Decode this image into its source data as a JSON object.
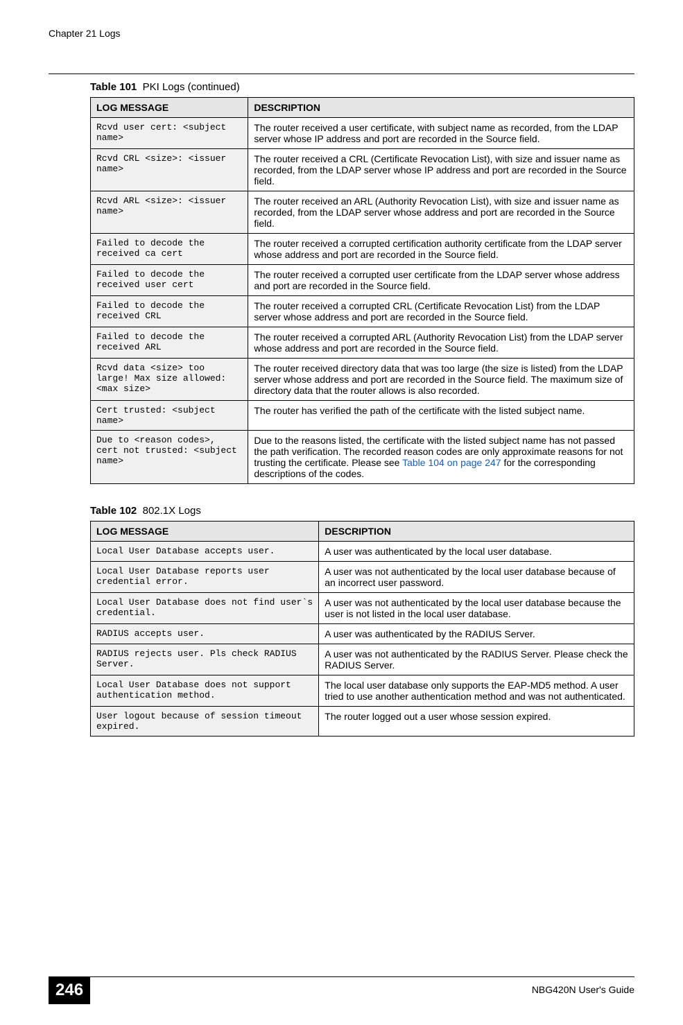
{
  "header": {
    "chapter": "Chapter 21 Logs"
  },
  "table1": {
    "caption_num": "Table 101",
    "caption_text": "PKI Logs (continued)",
    "col1": "LOG MESSAGE",
    "col2": "DESCRIPTION",
    "rows": [
      {
        "msg": "Rcvd user cert: <subject name>",
        "desc": "The router received a user certificate, with subject name as recorded, from the LDAP server whose IP address and port are recorded in the Source field."
      },
      {
        "msg": "Rcvd CRL <size>: <issuer name>",
        "desc": "The router received a CRL (Certificate Revocation List), with size and issuer name as recorded, from the LDAP server whose IP address and port are recorded in the Source field."
      },
      {
        "msg": "Rcvd ARL <size>: <issuer name>",
        "desc": "The router received an ARL (Authority Revocation List), with size and issuer name as recorded, from the LDAP server whose address and port are recorded in the Source field."
      },
      {
        "msg": "Failed to decode the received ca cert",
        "desc": "The router received a corrupted certification authority certificate from the LDAP server whose address and port are recorded in the Source field."
      },
      {
        "msg": "Failed to decode the received user cert",
        "desc": "The router received a corrupted user certificate from the LDAP server whose address and port are recorded in the Source field."
      },
      {
        "msg": "Failed to decode the received CRL",
        "desc": "The router received a corrupted CRL (Certificate Revocation List) from the LDAP server whose address and port are recorded in the Source field."
      },
      {
        "msg": "Failed to decode the received ARL",
        "desc": "The router received a corrupted ARL (Authority Revocation List) from the LDAP server whose address and port are recorded in the Source field."
      },
      {
        "msg": "Rcvd data <size> too large! Max size allowed: <max size>",
        "desc": "The router received directory data that was too large (the size is listed) from the LDAP server whose address and port are recorded in the Source field. The maximum size of directory data that the router allows is also recorded."
      },
      {
        "msg": "Cert trusted: <subject name>",
        "desc": "The router has verified the path of the certificate with the listed subject name."
      },
      {
        "msg": "Due to <reason codes>, cert not trusted: <subject name>",
        "desc_pre": "Due to the reasons listed, the certificate with the listed subject name has not passed the path verification. The recorded reason codes are only approximate reasons for not trusting the certificate. Please see ",
        "desc_link": "Table 104 on page 247",
        "desc_post": " for the corresponding descriptions of the codes."
      }
    ]
  },
  "table2": {
    "caption_num": "Table 102",
    "caption_text": "802.1X Logs",
    "col1": "LOG MESSAGE",
    "col2": "DESCRIPTION",
    "rows": [
      {
        "msg": "Local User Database accepts user.",
        "desc": "A user was authenticated by the local user database."
      },
      {
        "msg": "Local User Database reports user credential error.",
        "desc": "A user was not authenticated by the local user database because of an incorrect user password."
      },
      {
        "msg": "Local User Database does not find user`s credential.",
        "desc": "A user was not authenticated by the local user database because the user is not listed in the local user database."
      },
      {
        "msg": "RADIUS accepts user.",
        "desc": "A user was authenticated by the RADIUS Server."
      },
      {
        "msg": "RADIUS rejects user. Pls check RADIUS Server.",
        "desc": "A user was not authenticated by the RADIUS Server. Please check the RADIUS Server."
      },
      {
        "msg": "Local User Database does not support authentication method.",
        "desc": "The local user database only supports the EAP-MD5 method. A user tried to use another authentication method and was not authenticated."
      },
      {
        "msg": "User logout because of session timeout expired.",
        "desc": "The router logged out a user whose session expired."
      }
    ]
  },
  "footer": {
    "page": "246",
    "guide": "NBG420N User's Guide"
  }
}
